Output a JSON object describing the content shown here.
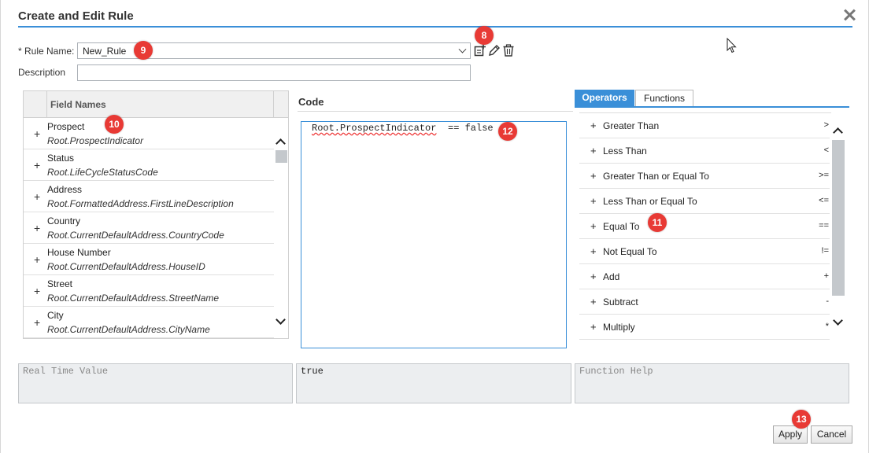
{
  "dialog": {
    "title": "Create and Edit Rule"
  },
  "form": {
    "rule_name_label": "* Rule Name:",
    "rule_name_value": "New_Rule",
    "description_label": "Description",
    "description_value": ""
  },
  "fields": {
    "header": "Field Names",
    "items": [
      {
        "name": "Prospect",
        "path": "Root.ProspectIndicator"
      },
      {
        "name": "Status",
        "path": "Root.LifeCycleStatusCode"
      },
      {
        "name": "Address",
        "path": "Root.FormattedAddress.FirstLineDescription"
      },
      {
        "name": "Country",
        "path": "Root.CurrentDefaultAddress.CountryCode"
      },
      {
        "name": "House Number",
        "path": "Root.CurrentDefaultAddress.HouseID"
      },
      {
        "name": "Street",
        "path": "Root.CurrentDefaultAddress.StreetName"
      },
      {
        "name": "City",
        "path": "Root.CurrentDefaultAddress.CityName"
      }
    ]
  },
  "code": {
    "title": "Code",
    "field_token": "Root.ProspectIndicator",
    "expression_rest": "== false"
  },
  "operators": {
    "tabs": [
      {
        "label": "Operators",
        "active": true
      },
      {
        "label": "Functions",
        "active": false
      }
    ],
    "items": [
      {
        "name": "Greater Than",
        "symbol": ">"
      },
      {
        "name": "Less Than",
        "symbol": "<"
      },
      {
        "name": "Greater Than or Equal To",
        "symbol": ">="
      },
      {
        "name": "Less Than or Equal To",
        "symbol": "<="
      },
      {
        "name": "Equal To",
        "symbol": "=="
      },
      {
        "name": "Not Equal To",
        "symbol": "!="
      },
      {
        "name": "Add",
        "symbol": "+"
      },
      {
        "name": "Subtract",
        "symbol": "-"
      },
      {
        "name": "Multiply",
        "symbol": "*"
      }
    ]
  },
  "panels": {
    "real_time_value_placeholder": "Real Time Value",
    "result_value": "true",
    "function_help_placeholder": "Function Help"
  },
  "buttons": {
    "apply": "Apply",
    "cancel": "Cancel"
  },
  "callouts": [
    "8",
    "9",
    "10",
    "11",
    "12",
    "13"
  ],
  "colors": {
    "accent": "#3a8fd8",
    "callout": "#e83a35",
    "panel_bg": "#eceef0"
  },
  "icons": [
    "add-rule-icon",
    "edit-pencil-icon",
    "trash-icon",
    "close-icon",
    "chevron-up-icon",
    "chevron-down-icon",
    "mouse-cursor-icon"
  ]
}
